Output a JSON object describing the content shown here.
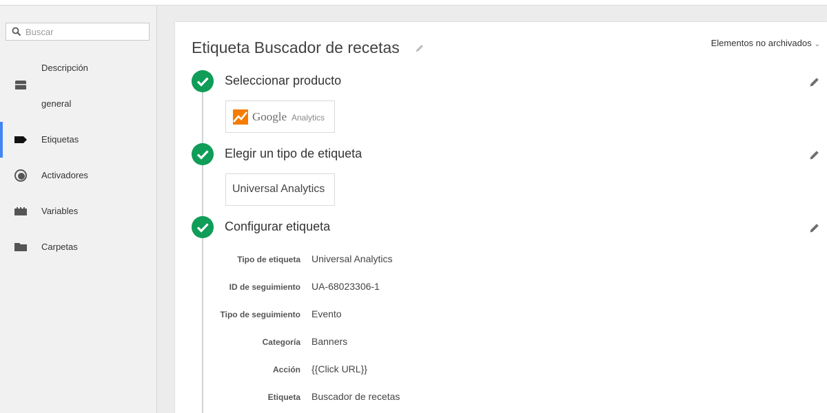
{
  "sidebar": {
    "search": {
      "placeholder": "Buscar",
      "value": ""
    },
    "items": [
      {
        "label_line1": "Descripción",
        "label_line2": "general",
        "icon": "inbox-icon"
      },
      {
        "label": "Etiquetas",
        "icon": "tag-icon",
        "active": true
      },
      {
        "label": "Activadores",
        "icon": "trigger-icon"
      },
      {
        "label": "Variables",
        "icon": "variables-icon"
      },
      {
        "label": "Carpetas",
        "icon": "folder-icon"
      }
    ]
  },
  "main": {
    "title": "Etiqueta Buscador de recetas",
    "filter_label": "Elementos no archivados",
    "steps": [
      {
        "title": "Seleccionar producto",
        "product": {
          "brand": "Google",
          "name": "Analytics"
        }
      },
      {
        "title": "Elegir un tipo de etiqueta",
        "tag_type": "Universal Analytics"
      },
      {
        "title": "Configurar etiqueta"
      }
    ],
    "config": [
      {
        "label": "Tipo de etiqueta",
        "value": "Universal Analytics"
      },
      {
        "label": "ID de seguimiento",
        "value": "UA-68023306-1"
      },
      {
        "label": "Tipo de seguimiento",
        "value": "Evento"
      },
      {
        "label": "Categoría",
        "value": "Banners"
      },
      {
        "label": "Acción",
        "value": "{{Click URL}}"
      },
      {
        "label": "Etiqueta",
        "value": "Buscador de recetas"
      }
    ]
  },
  "colors": {
    "accent": "#4285f4",
    "success": "#0f9d58",
    "ga_orange": "#f57c00"
  }
}
